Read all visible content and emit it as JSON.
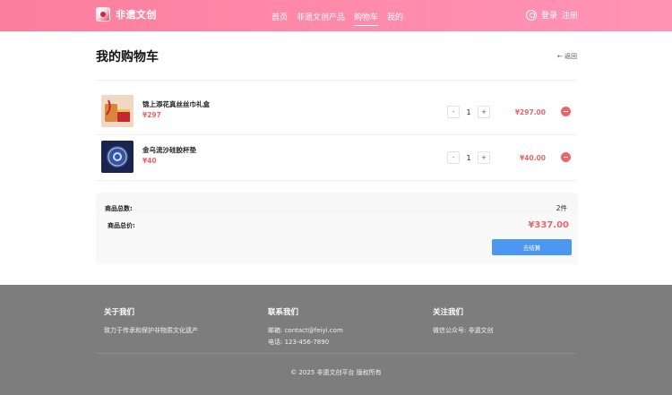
{
  "header": {
    "logo_text": "非遗文创",
    "nav": [
      "首页",
      "非遗文创产品",
      "购物车",
      "我的"
    ],
    "login": "登录",
    "register": "注册"
  },
  "cart": {
    "title": "我的购物车",
    "back": "← 返回",
    "items": [
      {
        "name": "锦上添花真丝丝巾礼盒",
        "price": "¥297",
        "qty": "1",
        "subtotal": "¥297.00"
      },
      {
        "name": "金乌流沙硅胶杯垫",
        "price": "¥40",
        "qty": "1",
        "subtotal": "¥40.00"
      }
    ],
    "minus": "-",
    "plus": "+"
  },
  "summary": {
    "count_label": "商品总数:",
    "count_value": "2件",
    "total_label": "商品总价:",
    "total_value": "¥337.00",
    "checkout": "去结算"
  },
  "footer": {
    "about_title": "关于我们",
    "about_text": "致力于传承和保护非物质文化遗产",
    "contact_title": "联系我们",
    "email": "邮箱: contact@feiyi.com",
    "phone": "电话: 123-456-7890",
    "follow_title": "关注我们",
    "wechat": "微信公众号: 非遗文创",
    "copyright": "© 2025 非遗文创平台 版权所有"
  }
}
